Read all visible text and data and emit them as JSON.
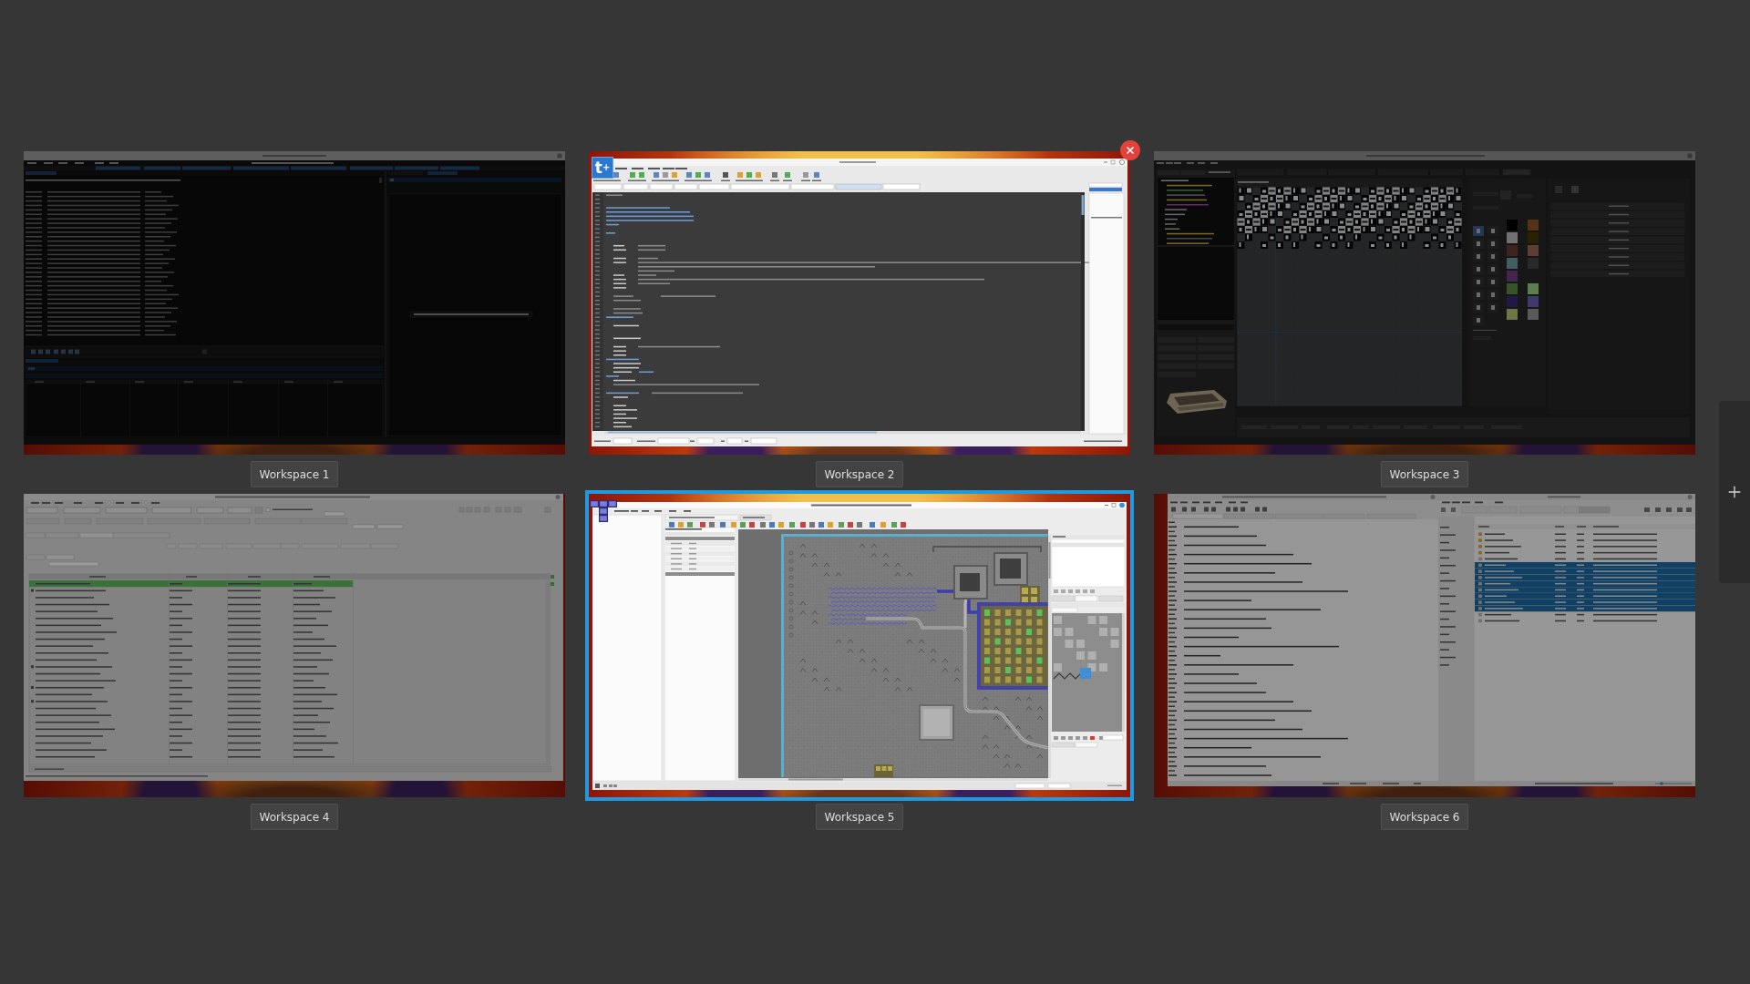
{
  "workspaces": [
    {
      "label": "Workspace 1",
      "kind": "hex_editor",
      "selected": false,
      "hovered": false
    },
    {
      "label": "Workspace 2",
      "kind": "code_editor",
      "selected": false,
      "hovered": true,
      "app_icon": {
        "kind": "letter",
        "text": "t$^{+}$"
      }
    },
    {
      "label": "Workspace 3",
      "kind": "char_editor",
      "selected": false,
      "hovered": false
    },
    {
      "label": "Workspace 4",
      "kind": "music_player",
      "selected": false,
      "hovered": false
    },
    {
      "label": "Workspace 5",
      "kind": "map_editor",
      "selected": true,
      "hovered": false,
      "app_icon": {
        "kind": "blocks"
      }
    },
    {
      "label": "Workspace 6",
      "kind": "editor_and_files",
      "selected": false,
      "hovered": false
    }
  ]
}
